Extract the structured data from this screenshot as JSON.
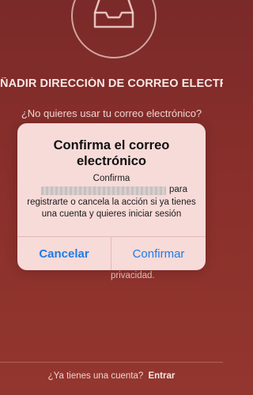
{
  "background": {
    "title": "ÑADIR DIRECCIÓN DE CORREO ELECTRÓNICO",
    "subtitle": "¿No quieres usar tu correo electrónico?",
    "privacy_fragment": "privacidad.",
    "footer_question": "¿Ya tienes una cuenta?",
    "footer_link": "Entrar"
  },
  "dialog": {
    "title": "Confirma el correo electrónico",
    "message_line1": "Confirma",
    "message_suffix": "para",
    "message_rest": "registrarte o cancela la acción si ya tienes una cuenta y quieres iniciar sesión",
    "cancel_label": "Cancelar",
    "confirm_label": "Confirmar",
    "button_color": "#1f7be6"
  }
}
